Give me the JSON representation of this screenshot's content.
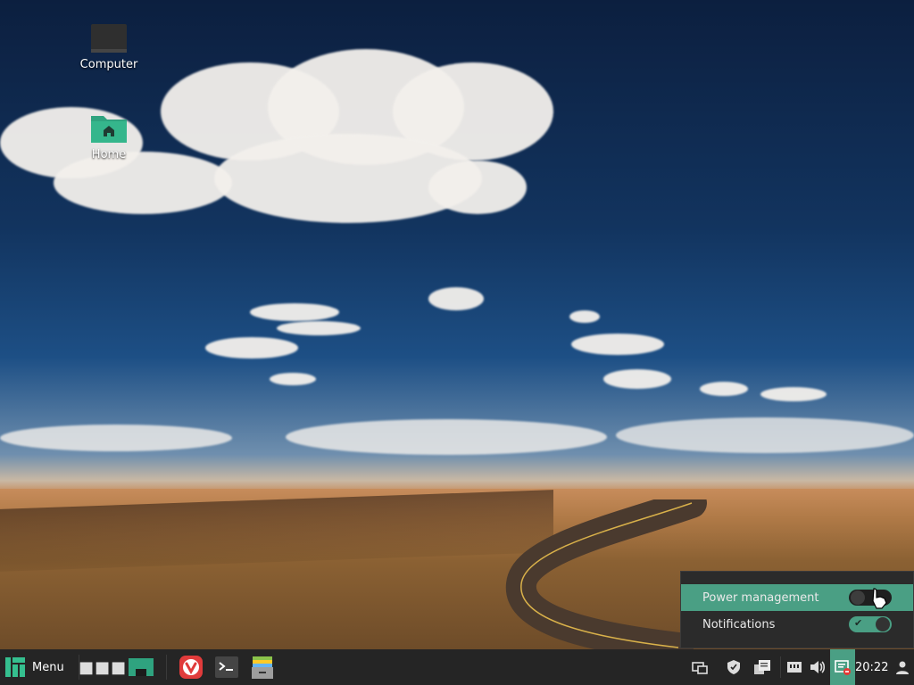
{
  "desktop": {
    "icons": [
      {
        "label": "Computer"
      },
      {
        "label": "Home"
      }
    ]
  },
  "popup": {
    "items": [
      {
        "label": "Power management",
        "enabled": false,
        "highlighted": true
      },
      {
        "label": "Notifications",
        "enabled": true,
        "highlighted": false
      }
    ]
  },
  "taskbar": {
    "menu_label": "Menu",
    "clock": "20:22",
    "accent": "#4a9f84"
  }
}
